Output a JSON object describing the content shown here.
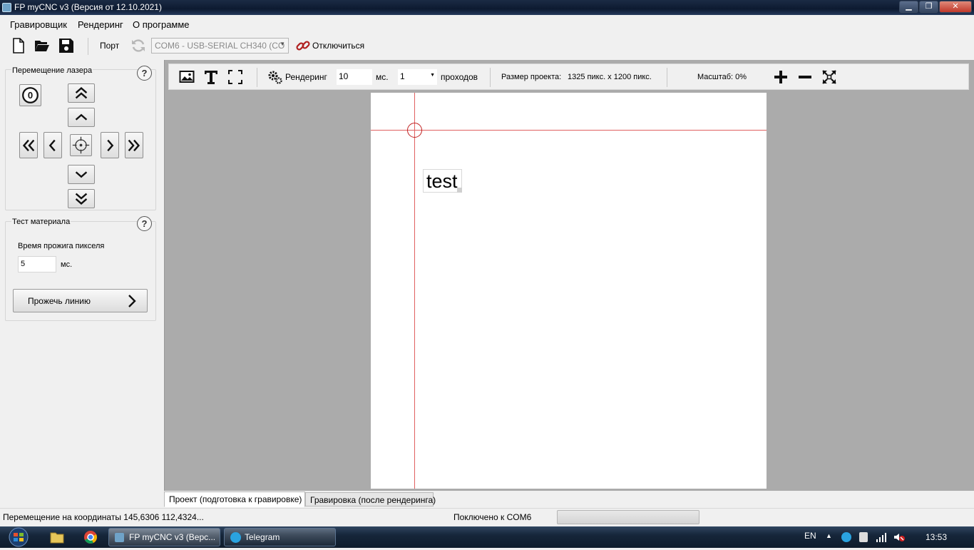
{
  "window": {
    "title": "FP myCNC v3 (Версия от 12.10.2021)",
    "minimize_glyph": "▁",
    "maximize_glyph": "❐",
    "close_glyph": "✕"
  },
  "menu": {
    "items": [
      "Гравировщик",
      "Рендеринг",
      "О программе"
    ]
  },
  "toolbar": {
    "port_label": "Порт",
    "port_value": "COM6 - USB-SERIAL CH340 (CO",
    "disconnect_label": "Отключиться"
  },
  "laser_move": {
    "title": "Перемещение лазера",
    "help": "?",
    "home_glyph": "0"
  },
  "material_test": {
    "title": "Тест материала",
    "help": "?",
    "burn_time_label": "Время прожига пикселя",
    "burn_time_value": "5",
    "burn_time_unit": "мс.",
    "burn_line_button": "Прожечь линию"
  },
  "editor_toolbar": {
    "render_label": "Рендеринг",
    "render_ms_value": "10",
    "render_ms_unit": "мс.",
    "passes_value": "1",
    "passes_label": "проходов",
    "project_size_label": "Размер проекта:",
    "project_size_value": "1325 пикс. x 1200 пикс.",
    "scale_label": "Масштаб: 0%"
  },
  "canvas": {
    "text_object": "test"
  },
  "tabs": [
    {
      "label": "Проект (подготовка к гравировке)",
      "active": true
    },
    {
      "label": "Гравировка (после рендеринга)",
      "active": false
    }
  ],
  "status": {
    "left": "Перемещение на координаты 145,6306 112,4324...",
    "connection": "Поключено к COM6"
  },
  "taskbar": {
    "apps": [
      "FP myCNC v3 (Верс...",
      "Telegram"
    ],
    "lang": "EN",
    "clock": "13:53"
  },
  "colors": {
    "workspace_bg": "#ababab",
    "crosshair": "#d33333",
    "link_icon": "#b02020"
  }
}
